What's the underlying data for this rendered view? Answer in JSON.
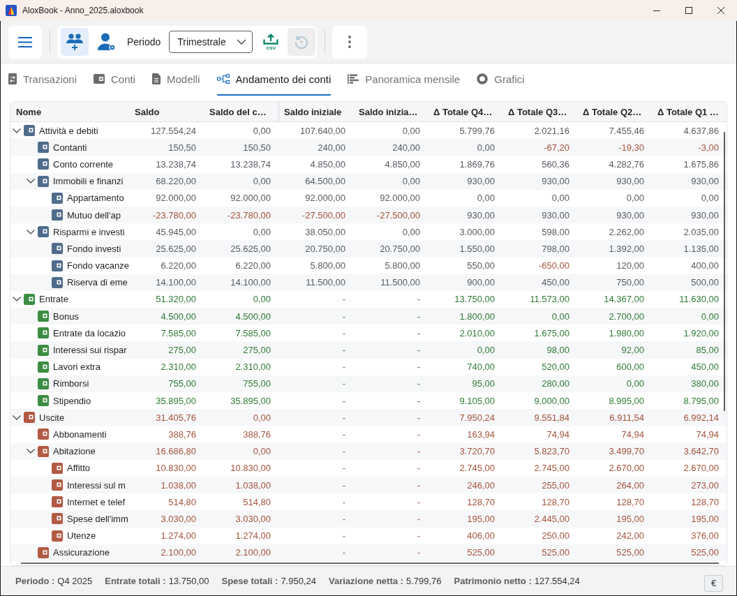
{
  "window": {
    "title": "AloxBook - Anno_2025.aloxbook"
  },
  "toolbar": {
    "add_button": {
      "selected": true
    },
    "profile_button": {
      "selected": false
    },
    "period_label": "Periodo",
    "period": "Trimestrale",
    "export_label": "csv",
    "history_button": {
      "disabled": true
    }
  },
  "tabs": [
    {
      "label": "Transazioni",
      "selected": false
    },
    {
      "label": "Conti",
      "selected": false
    },
    {
      "label": "Modelli",
      "selected": false
    },
    {
      "label": "Andamento dei conti",
      "selected": true
    },
    {
      "label": "Panoramica mensile",
      "selected": false
    },
    {
      "label": "Grafici",
      "selected": false
    }
  ],
  "table": {
    "columns": [
      "Nome",
      "Saldo",
      "Saldo del c…",
      "Saldo iniziale",
      "Saldo inizia…",
      "Δ Totale Q4…",
      "Δ Totale Q3…",
      "Δ Totale Q2…",
      "Δ Totale Q1 …"
    ],
    "rows": [
      {
        "name": "Attività e debiti",
        "kind": "asset",
        "expanded": true,
        "values": [
          "127.554,24",
          "0,00",
          "107.640,00",
          "0,00",
          "5.799,76",
          "2.021,16",
          "7.455,46",
          "4.637,86"
        ],
        "children": [
          {
            "name": "Contanti",
            "values": [
              "150,50",
              "150,50",
              "240,00",
              "240,00",
              "0,00",
              "-67,20",
              "-19,30",
              "-3,00"
            ],
            "negative": [
              false,
              false,
              false,
              false,
              false,
              true,
              true,
              true
            ]
          },
          {
            "name": "Conto corrente",
            "values": [
              "13.238,74",
              "13.238,74",
              "4.850,00",
              "4.850,00",
              "1.869,76",
              "560,36",
              "4.282,76",
              "1.675,86"
            ]
          },
          {
            "name": "Immobili e finanzi",
            "expanded": true,
            "values": [
              "68.220,00",
              "0,00",
              "64.500,00",
              "0,00",
              "930,00",
              "930,00",
              "930,00",
              "930,00"
            ],
            "children": [
              {
                "name": "Appartamento",
                "values": [
                  "92.000,00",
                  "92.000,00",
                  "92.000,00",
                  "92.000,00",
                  "0,00",
                  "0,00",
                  "0,00",
                  "0,00"
                ]
              },
              {
                "name": "Mutuo dell'ap",
                "values": [
                  "-23.780,00",
                  "-23.780,00",
                  "-27.500,00",
                  "-27.500,00",
                  "930,00",
                  "930,00",
                  "930,00",
                  "930,00"
                ],
                "negative": [
                  true,
                  true,
                  true,
                  true,
                  false,
                  false,
                  false,
                  false
                ]
              }
            ]
          },
          {
            "name": "Risparmi e investi",
            "expanded": true,
            "values": [
              "45.945,00",
              "0,00",
              "38.050,00",
              "0,00",
              "3.000,00",
              "598,00",
              "2.262,00",
              "2.035,00"
            ],
            "children": [
              {
                "name": "Fondo investi",
                "values": [
                  "25.625,00",
                  "25.625,00",
                  "20.750,00",
                  "20.750,00",
                  "1.550,00",
                  "798,00",
                  "1.392,00",
                  "1.135,00"
                ]
              },
              {
                "name": "Fondo vacanze",
                "values": [
                  "6.220,00",
                  "6.220,00",
                  "5.800,00",
                  "5.800,00",
                  "550,00",
                  "-650,00",
                  "120,00",
                  "400,00"
                ],
                "negative": [
                  false,
                  false,
                  false,
                  false,
                  false,
                  true,
                  false,
                  false
                ]
              },
              {
                "name": "Riserva di eme",
                "values": [
                  "14.100,00",
                  "14.100,00",
                  "11.500,00",
                  "11.500,00",
                  "900,00",
                  "450,00",
                  "750,00",
                  "500,00"
                ]
              }
            ]
          }
        ]
      },
      {
        "name": "Entrate",
        "kind": "income",
        "expanded": true,
        "values": [
          "51.320,00",
          "0,00",
          "-",
          "-",
          "13.750,00",
          "11.573,00",
          "14.367,00",
          "11.630,00"
        ],
        "children": [
          {
            "name": "Bonus",
            "values": [
              "4.500,00",
              "4.500,00",
              "-",
              "-",
              "1.800,00",
              "0,00",
              "2.700,00",
              "0,00"
            ]
          },
          {
            "name": "Entrate da locazio",
            "values": [
              "7.585,00",
              "7.585,00",
              "-",
              "-",
              "2.010,00",
              "1.675,00",
              "1.980,00",
              "1.920,00"
            ]
          },
          {
            "name": "Interessi sui rispar",
            "values": [
              "275,00",
              "275,00",
              "-",
              "-",
              "0,00",
              "98,00",
              "92,00",
              "85,00"
            ]
          },
          {
            "name": "Lavori extra",
            "values": [
              "2.310,00",
              "2.310,00",
              "-",
              "-",
              "740,00",
              "520,00",
              "600,00",
              "450,00"
            ]
          },
          {
            "name": "Rimborsi",
            "values": [
              "755,00",
              "755,00",
              "-",
              "-",
              "95,00",
              "280,00",
              "0,00",
              "380,00"
            ]
          },
          {
            "name": "Stipendio",
            "values": [
              "35.895,00",
              "35.895,00",
              "-",
              "-",
              "9.105,00",
              "9.000,00",
              "8.995,00",
              "8.795,00"
            ]
          }
        ]
      },
      {
        "name": "Uscite",
        "kind": "expense",
        "expanded": true,
        "values": [
          "31.405,76",
          "0,00",
          "-",
          "-",
          "7.950,24",
          "9.551,84",
          "6.911,54",
          "6.992,14"
        ],
        "children": [
          {
            "name": "Abbonamenti",
            "values": [
              "388,76",
              "388,76",
              "-",
              "-",
              "163,94",
              "74,94",
              "74,94",
              "74,94"
            ]
          },
          {
            "name": "Abitazione",
            "expanded": true,
            "values": [
              "16.686,80",
              "0,00",
              "-",
              "-",
              "3.720,70",
              "5.823,70",
              "3.499,70",
              "3.642,70"
            ],
            "children": [
              {
                "name": "Affitto",
                "values": [
                  "10.830,00",
                  "10.830,00",
                  "-",
                  "-",
                  "2.745,00",
                  "2.745,00",
                  "2.670,00",
                  "2.670,00"
                ]
              },
              {
                "name": "Interessi sul m",
                "values": [
                  "1.038,00",
                  "1.038,00",
                  "-",
                  "-",
                  "246,00",
                  "255,00",
                  "264,00",
                  "273,00"
                ]
              },
              {
                "name": "Internet e telef",
                "values": [
                  "514,80",
                  "514,80",
                  "-",
                  "-",
                  "128,70",
                  "128,70",
                  "128,70",
                  "128,70"
                ]
              },
              {
                "name": "Spese dell'imm",
                "values": [
                  "3.030,00",
                  "3.030,00",
                  "-",
                  "-",
                  "195,00",
                  "2.445,00",
                  "195,00",
                  "195,00"
                ]
              },
              {
                "name": "Utenze",
                "values": [
                  "1.274,00",
                  "1.274,00",
                  "-",
                  "-",
                  "406,00",
                  "250,00",
                  "242,00",
                  "376,00"
                ]
              }
            ]
          },
          {
            "name": "Assicurazione",
            "values": [
              "2.100,00",
              "2.100,00",
              "-",
              "-",
              "525,00",
              "525,00",
              "525,00",
              "525,00"
            ]
          }
        ]
      }
    ]
  },
  "status_bar": {
    "items": [
      {
        "label": "Periodo :",
        "value": "Q4 2025"
      },
      {
        "label": "Entrate totali :",
        "value": "13.750,00"
      },
      {
        "label": "Spese totali :",
        "value": "7.950,24"
      },
      {
        "label": "Variazione netta :",
        "value": "5.799,76"
      },
      {
        "label": "Patrimonio netto :",
        "value": "127.554,24"
      }
    ],
    "currency_button": "€"
  }
}
